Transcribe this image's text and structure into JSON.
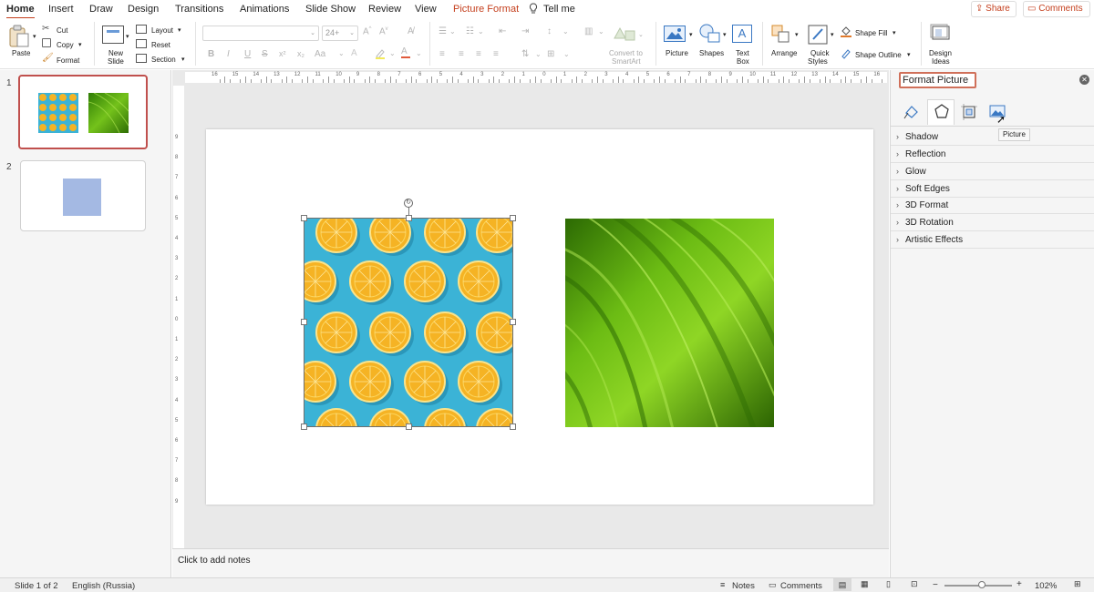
{
  "menu": {
    "tabs": [
      "Home",
      "Insert",
      "Draw",
      "Design",
      "Transitions",
      "Animations",
      "Slide Show",
      "Review",
      "View",
      "Picture Format",
      "Tell me"
    ],
    "share": "Share",
    "comments": "Comments"
  },
  "ribbon": {
    "paste": "Paste",
    "cut": "Cut",
    "copy": "Copy",
    "format": "Format",
    "new_slide_1": "New",
    "new_slide_2": "Slide",
    "layout": "Layout",
    "reset": "Reset",
    "section": "Section",
    "font_name": "",
    "font_size": "24+",
    "bold": "B",
    "italic": "I",
    "underline": "U",
    "strike": "S",
    "superscript": "x²",
    "subscript": "x₂",
    "change_case": "Aa",
    "convert_smartart_1": "Convert to",
    "convert_smartart_2": "SmartArt",
    "picture": "Picture",
    "shapes": "Shapes",
    "text_box_1": "Text",
    "text_box_2": "Box",
    "arrange": "Arrange",
    "quick_styles_1": "Quick",
    "quick_styles_2": "Styles",
    "shape_fill": "Shape Fill",
    "shape_outline": "Shape Outline",
    "design_ideas_1": "Design",
    "design_ideas_2": "Ideas"
  },
  "slides": [
    {
      "number": "1",
      "selected": true
    },
    {
      "number": "2",
      "selected": false
    }
  ],
  "ruler": {
    "h_ticks": [
      "16",
      "15",
      "14",
      "13",
      "12",
      "11",
      "10",
      "9",
      "8",
      "7",
      "6",
      "5",
      "4",
      "3",
      "2",
      "1",
      "0",
      "1",
      "2",
      "3",
      "4",
      "5",
      "6",
      "7",
      "8",
      "9",
      "10",
      "11",
      "12",
      "13",
      "14",
      "15",
      "16"
    ],
    "v_ticks": [
      "9",
      "8",
      "7",
      "6",
      "5",
      "4",
      "3",
      "2",
      "1",
      "0",
      "1",
      "2",
      "3",
      "4",
      "5",
      "6",
      "7",
      "8",
      "9"
    ]
  },
  "notes": {
    "placeholder": "Click to add notes"
  },
  "format_pane": {
    "title": "Format Picture",
    "tooltip": "Picture",
    "sections": [
      "Shadow",
      "Reflection",
      "Glow",
      "Soft Edges",
      "3D Format",
      "3D Rotation",
      "Artistic Effects"
    ]
  },
  "status": {
    "slide_info": "Slide 1 of 2",
    "language": "English (Russia)",
    "notes": "Notes",
    "comments": "Comments",
    "zoom": "102%",
    "zoom_fraction": 0.55
  },
  "colors": {
    "accent": "#c43e1c",
    "orange_bg": "#3bb3d6",
    "orange": "#f5b324",
    "leaf": "#5aa512",
    "shape_fill_slide2": "#a4b9e3"
  }
}
